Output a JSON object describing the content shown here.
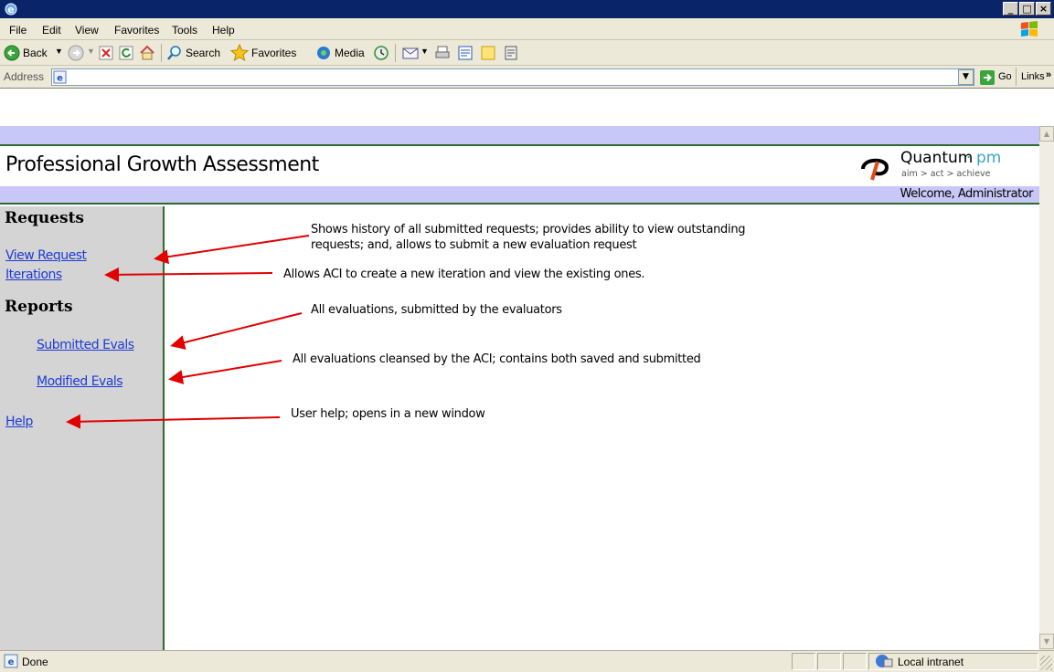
{
  "menu": [
    "File",
    "Edit",
    "View",
    "Favorites",
    "Tools",
    "Help"
  ],
  "toolbar": {
    "back": "Back",
    "search": "Search",
    "favorites": "Favorites",
    "media": "Media"
  },
  "address": {
    "label": "Address",
    "go": "Go",
    "links": "Links"
  },
  "page": {
    "title": "Professional Growth Assessment",
    "logo_name": "Quantum",
    "logo_dot": "·",
    "logo_pm": "pm",
    "logo_tagline": "aim > act > achieve",
    "welcome": "Welcome, Administrator"
  },
  "nav": {
    "requests_heading": "Requests",
    "view_request": "View Request",
    "iterations": "Iterations",
    "reports_heading": "Reports",
    "submitted_evals": "Submitted Evals",
    "modified_evals": "Modified Evals",
    "help": "Help"
  },
  "annotations": {
    "view_request_line1": "Shows history of all submitted requests; provides ability to view outstanding",
    "view_request_line2": "requests; and, allows to submit a new evaluation request",
    "iterations": "Allows ACI to create a new iteration and view the existing ones.",
    "submitted": "All evaluations, submitted by the evaluators",
    "modified": "All evaluations cleansed by the ACI; contains both saved and submitted",
    "help": "User help; opens in a new window"
  },
  "status": {
    "text": "Done",
    "zone": "Local intranet"
  },
  "colors": {
    "titlebar": "#0a246a",
    "band": "#c8c8f8",
    "rule": "#2e6b2e",
    "link": "#1d3bd6",
    "arrow": "#e00000",
    "nav_bg": "#d4d4d4"
  }
}
